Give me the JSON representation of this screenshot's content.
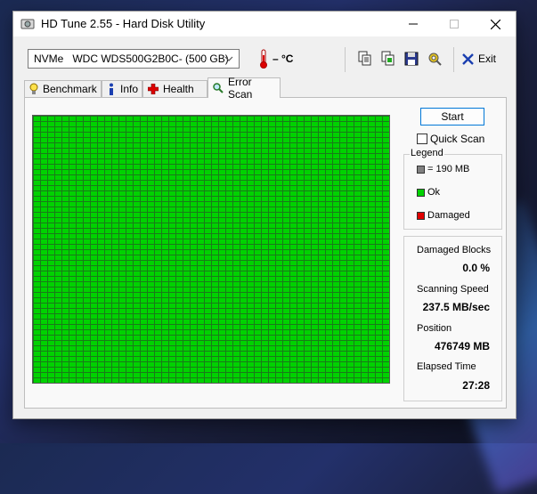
{
  "window": {
    "title": "HD Tune 2.55 - Hard Disk Utility"
  },
  "toolbar": {
    "drive": {
      "selected": "NVMe   WDC WDS500G2B0C- (500 GB)"
    },
    "temperature": "– °C",
    "exit_label": "Exit"
  },
  "tabs": [
    {
      "label": "Benchmark",
      "icon": "lightbulb-icon"
    },
    {
      "label": "Info",
      "icon": "info-icon"
    },
    {
      "label": "Health",
      "icon": "health-cross-icon"
    },
    {
      "label": "Error Scan",
      "icon": "magnifier-icon",
      "active": true
    }
  ],
  "scan": {
    "start_label": "Start",
    "quick_scan_label": "Quick Scan",
    "quick_scan_checked": false,
    "block_status": "all-ok",
    "block_colors": {
      "ok": "#00d200",
      "grid_line": "#1a7a1a"
    }
  },
  "legend": {
    "title": "Legend",
    "items": [
      {
        "label": "= 190 MB",
        "color": "#808080"
      },
      {
        "label": "Ok",
        "color": "#00d200"
      },
      {
        "label": "Damaged",
        "color": "#e00000"
      }
    ]
  },
  "stats": {
    "damaged_blocks_label": "Damaged Blocks",
    "damaged_blocks_value": "0.0 %",
    "scanning_speed_label": "Scanning Speed",
    "scanning_speed_value": "237.5 MB/sec",
    "position_label": "Position",
    "position_value": "476749 MB",
    "elapsed_label": "Elapsed Time",
    "elapsed_value": "27:28"
  }
}
